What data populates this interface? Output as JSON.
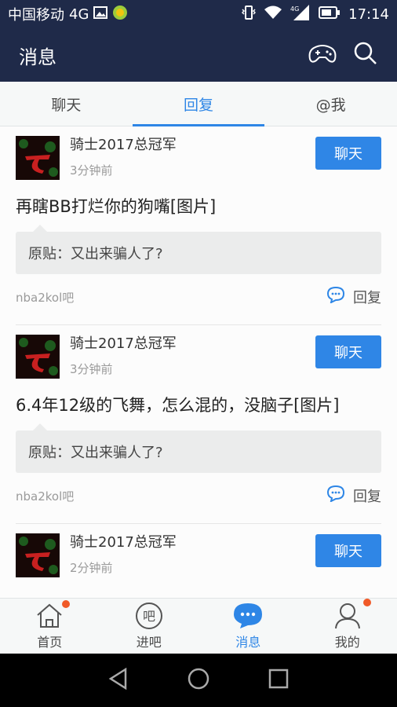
{
  "status_bar": {
    "carrier": "中国移动",
    "network": "4G",
    "time": "17:14",
    "signal_label_top": "4G",
    "signal_label_bottom": "G"
  },
  "app_bar": {
    "title": "消息"
  },
  "tabs": [
    {
      "label": "聊天",
      "active": false
    },
    {
      "label": "回复",
      "active": true
    },
    {
      "label": "@我",
      "active": false
    }
  ],
  "messages": [
    {
      "username": "骑士2017总冠军",
      "time": "3分钟前",
      "chat_label": "聊天",
      "content": "再瞎BB打烂你的狗嘴[图片]",
      "quote": "原贴：又出来骗人了?",
      "forum": "nba2kol吧",
      "reply_label": "回复"
    },
    {
      "username": "骑士2017总冠军",
      "time": "3分钟前",
      "chat_label": "聊天",
      "content": "6.4年12级的飞舞，怎么混的，没脑子[图片]",
      "quote": "原贴：又出来骗人了?",
      "forum": "nba2kol吧",
      "reply_label": "回复"
    },
    {
      "username": "骑士2017总冠军",
      "time": "2分钟前",
      "chat_label": "聊天"
    }
  ],
  "bottom_nav": [
    {
      "label": "首页",
      "icon": "home-icon",
      "badge": true,
      "active": false
    },
    {
      "label": "进吧",
      "icon": "ba-icon",
      "badge": false,
      "active": false
    },
    {
      "label": "消息",
      "icon": "message-icon",
      "badge": false,
      "active": true
    },
    {
      "label": "我的",
      "icon": "profile-icon",
      "badge": true,
      "active": false
    }
  ],
  "colors": {
    "header_bg": "#1f2a49",
    "accent": "#2e86e6",
    "badge": "#f05a28"
  }
}
